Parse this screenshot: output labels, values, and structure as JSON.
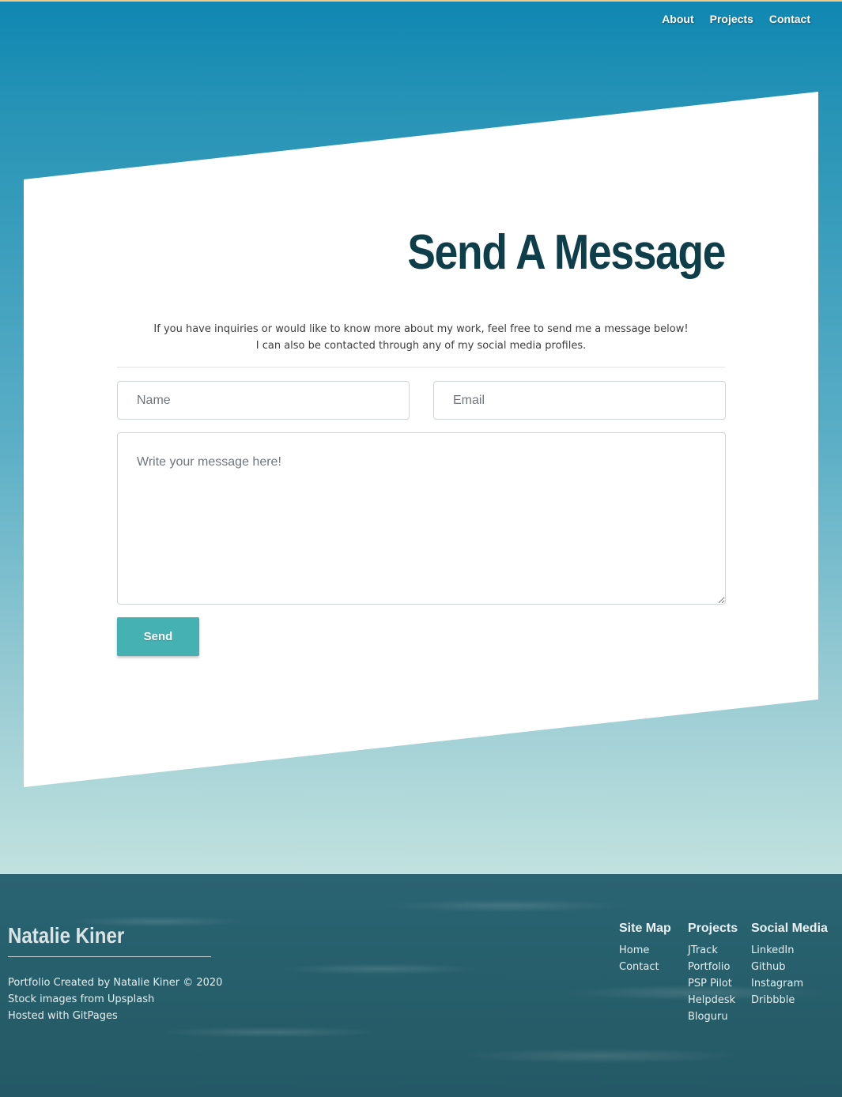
{
  "nav": {
    "items": [
      "About",
      "Projects",
      "Contact"
    ]
  },
  "contact": {
    "title": "Send A Message",
    "intro_line1": "If you have inquiries or would like to know more about my work, feel free to send me a message below!",
    "intro_line2": "I can also be contacted through any of my social media profiles.",
    "name_placeholder": "Name",
    "email_placeholder": "Email",
    "message_placeholder": "Write your message here!",
    "send_label": "Send"
  },
  "footer": {
    "brand": "Natalie Kiner",
    "credits": [
      "Portfolio Created by Natalie Kiner © 2020",
      "Stock images from Upsplash",
      "Hosted with GitPages"
    ],
    "columns": [
      {
        "heading": "Site Map",
        "links": [
          "Home",
          "Contact"
        ]
      },
      {
        "heading": "Projects",
        "links": [
          "JTrack",
          "Portfolio",
          "PSP Pilot",
          "Helpdesk",
          "Bloguru"
        ]
      },
      {
        "heading": "Social Media",
        "links": [
          "LinkedIn",
          "Github",
          "Instagram",
          "Dribbble"
        ]
      }
    ]
  },
  "colors": {
    "accent": "#45b1b3",
    "title": "#0f3e4b",
    "hero_top": "#0f87b2",
    "hero_bottom": "#c1e2df",
    "footer": "#265c68"
  }
}
